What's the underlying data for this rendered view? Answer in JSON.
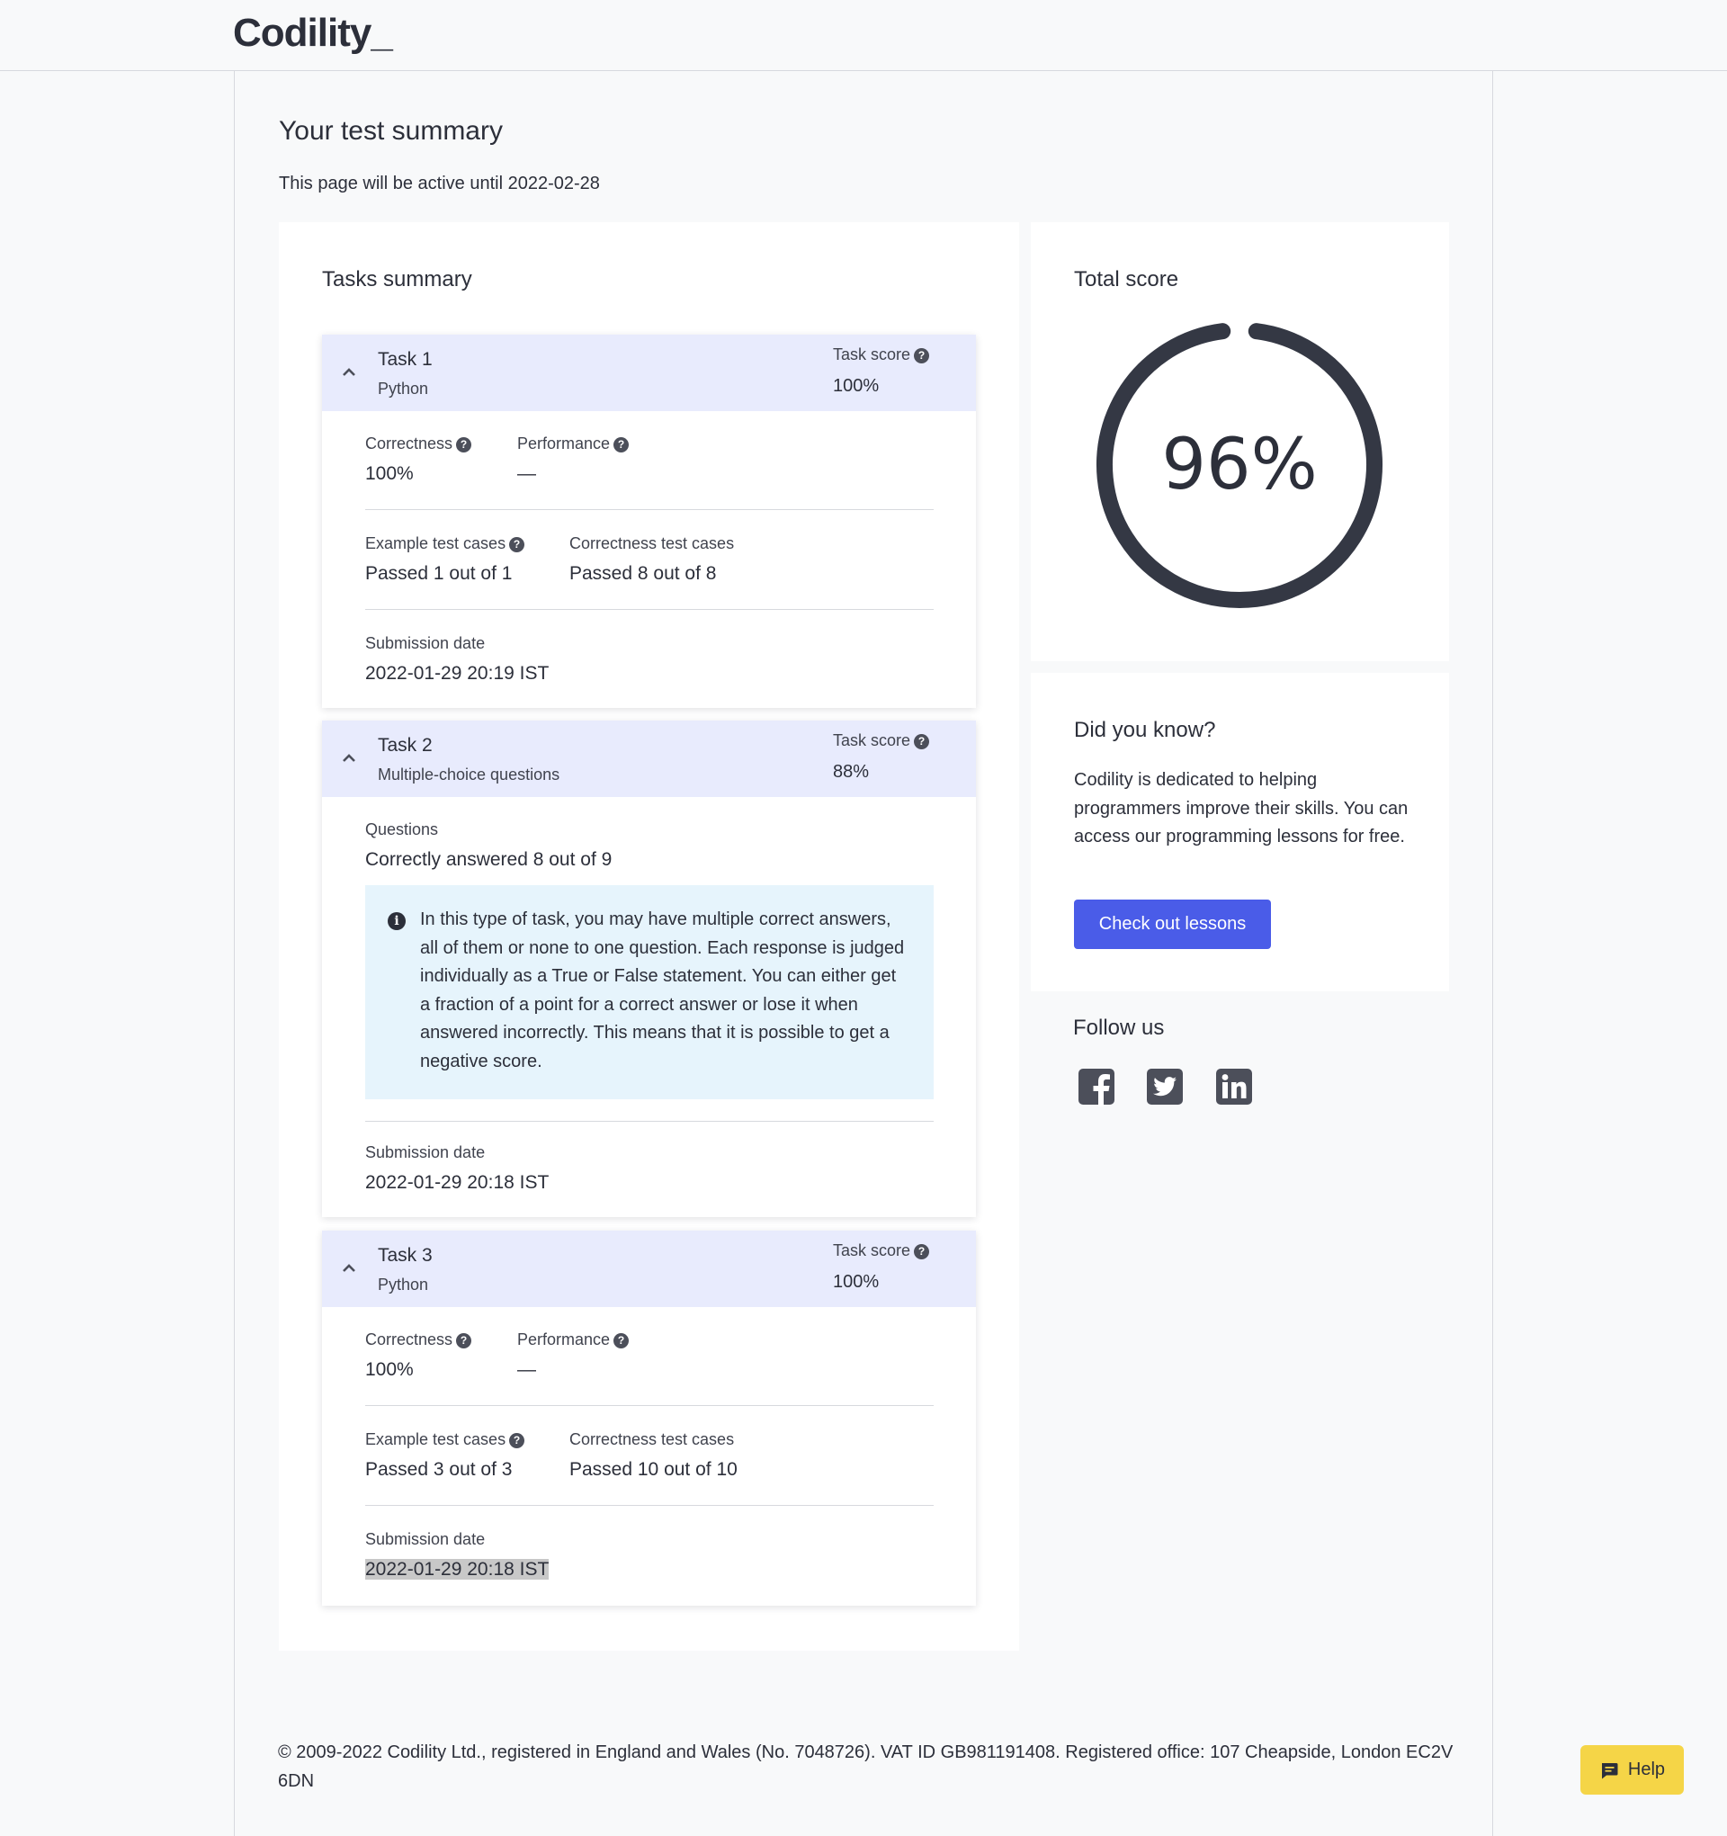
{
  "header": {
    "logo": "Codility",
    "logo_suffix": "_"
  },
  "page": {
    "title": "Your test summary",
    "active_until": "This page will be active until 2022-02-28"
  },
  "tasks_summary": {
    "title": "Tasks summary",
    "tasks": [
      {
        "name": "Task 1",
        "subtitle": "Python",
        "score_label": "Task score",
        "score": "100%",
        "correctness_label": "Correctness",
        "correctness": "100%",
        "performance_label": "Performance",
        "performance": "—",
        "example_label": "Example test cases",
        "example": "Passed 1 out of 1",
        "correctness_cases_label": "Correctness test cases",
        "correctness_cases": "Passed 8 out of 8",
        "submission_label": "Submission date",
        "submission": "2022-01-29 20:19 IST"
      },
      {
        "name": "Task 2",
        "subtitle": "Multiple-choice questions",
        "score_label": "Task score",
        "score": "88%",
        "questions_label": "Questions",
        "questions": "Correctly answered 8 out of 9",
        "info": "In this type of task, you may have multiple correct answers, all of them or none to one question. Each response is judged individually as a True or False statement. You can either get a fraction of a point for a correct answer or lose it when answered incorrectly. This means that it is possible to get a negative score.",
        "submission_label": "Submission date",
        "submission": "2022-01-29 20:18 IST"
      },
      {
        "name": "Task 3",
        "subtitle": "Python",
        "score_label": "Task score",
        "score": "100%",
        "correctness_label": "Correctness",
        "correctness": "100%",
        "performance_label": "Performance",
        "performance": "—",
        "example_label": "Example test cases",
        "example": "Passed 3 out of 3",
        "correctness_cases_label": "Correctness test cases",
        "correctness_cases": "Passed 10 out of 10",
        "submission_label": "Submission date",
        "submission": "2022-01-29 20:18 IST"
      }
    ]
  },
  "total_score": {
    "title": "Total score",
    "value": "96%",
    "fraction": 0.96,
    "ring_color": "#343844"
  },
  "did_you_know": {
    "title": "Did you know?",
    "text": "Codility is dedicated to helping programmers improve their skills. You can access our programming lessons for free.",
    "button": "Check out lessons"
  },
  "follow": {
    "title": "Follow us",
    "icons": [
      "facebook-icon",
      "twitter-icon",
      "linkedin-icon"
    ]
  },
  "footer": {
    "text": "© 2009-2022 Codility Ltd., registered in England and Wales (No. 7048726). VAT ID GB981191408. Registered office: 107 Cheapside, London EC2V 6DN"
  },
  "help": {
    "label": "Help"
  },
  "colors": {
    "accent": "#4a5ce8",
    "task_header": "#e8ebfd",
    "info_box": "#e6f4fc",
    "help_button": "#f5d547"
  }
}
